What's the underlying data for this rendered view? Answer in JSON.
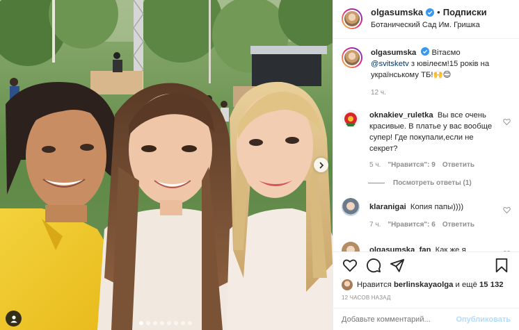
{
  "colors": {
    "accent": "#0095f6",
    "verified": "#3897f0",
    "muted": "#8e8e8e",
    "post_disabled": "#b3dbff"
  },
  "header": {
    "username": "olgasumska",
    "separator": "•",
    "follow_label": "Подписки",
    "location": "Ботанический Сад Им. Гришка"
  },
  "caption": {
    "username": "olgasumska",
    "text_before": "Вітаємо",
    "mention": "@svitsketv",
    "text_after": "з ювілеєм!15 років на українському ТБ!🙌😊",
    "time": "12 ч."
  },
  "comments": [
    {
      "username": "oknakiev_ruletka",
      "text": "Вы все очень красивые. В платье у вас вообще супер! Где покупали,если не секрет?",
      "time": "5 ч.",
      "likes": "\"Нравится\": 9",
      "reply": "Ответить",
      "view_replies": "Посмотреть ответы (1)"
    },
    {
      "username": "klaranigai",
      "text": "Копия папы))))",
      "time": "7 ч.",
      "likes": "\"Нравится\": 6",
      "reply": "Ответить"
    },
    {
      "username": "olgasumska_fan",
      "text": "Как же я"
    }
  ],
  "actions": {
    "like_icon": "heart-icon",
    "comment_icon": "comment-icon",
    "share_icon": "share-icon",
    "save_icon": "bookmark-icon"
  },
  "likes": {
    "prefix": "Нравится",
    "user": "berlinskayaolga",
    "suffix": "и ещё",
    "count": "15 132"
  },
  "timestamp": "12 ЧАСОВ НАЗАД",
  "add_comment": {
    "placeholder": "Добавьте комментарий...",
    "post_label": "Опубликовать"
  },
  "carousel": {
    "slides": 8,
    "current": 1
  }
}
